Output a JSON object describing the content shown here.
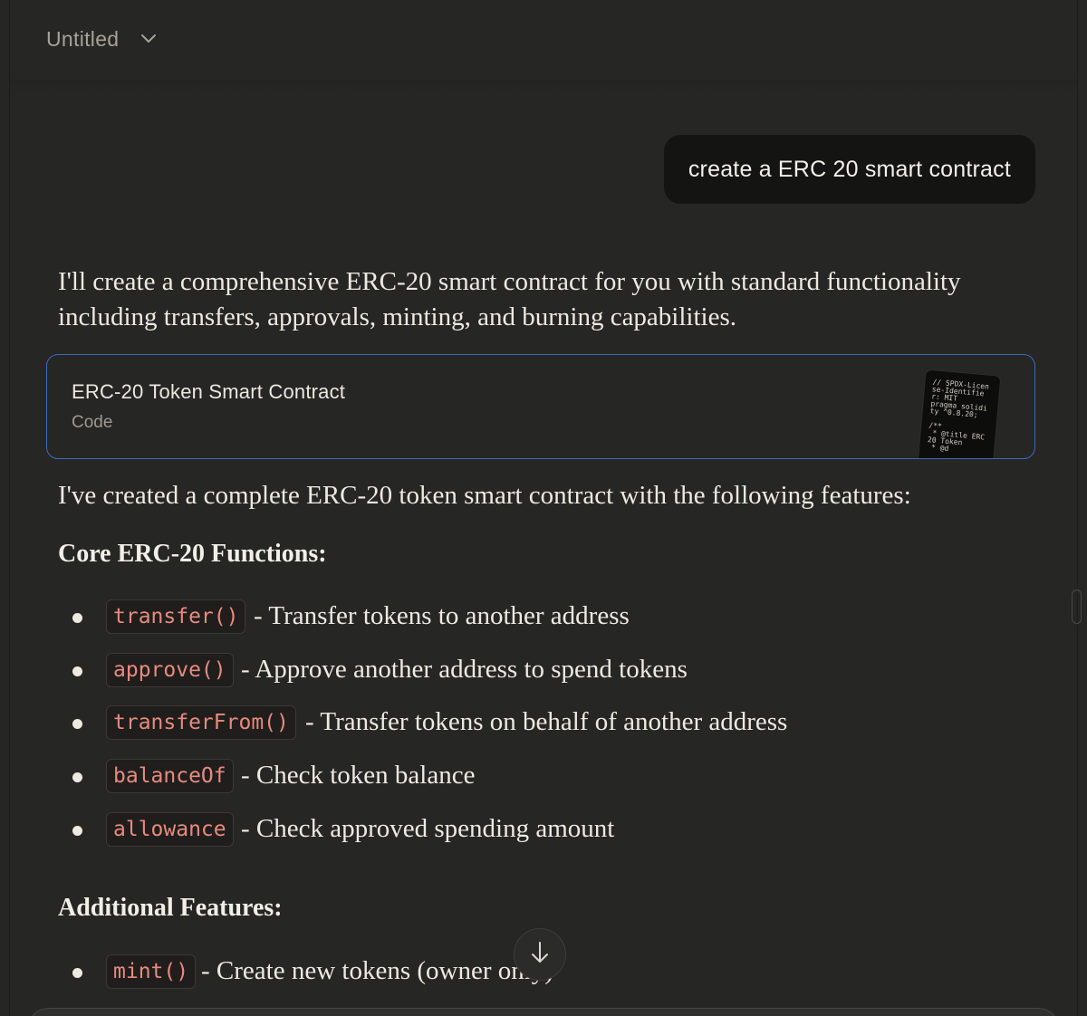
{
  "header": {
    "title": "Untitled"
  },
  "user_message": "create a ERC 20 smart contract",
  "assistant": {
    "intro": "I'll create a comprehensive ERC-20 smart contract for you with standard functionality including transfers, approvals, minting, and burning capabilities.",
    "artifact": {
      "title": "ERC-20 Token Smart Contract",
      "type": "Code",
      "preview": "// SPDX-License-Identifier: MIT\npragma solidity ^0.8.20;\n\n/**\n * @title ERC20 Token\n * @d"
    },
    "summary": "I've created a complete ERC-20 token smart contract with the following features:",
    "core_heading": "Core ERC-20 Functions:",
    "core_items": [
      {
        "code": "transfer()",
        "desc": "- Transfer tokens to another address"
      },
      {
        "code": "approve()",
        "desc": "- Approve another address to spend tokens"
      },
      {
        "code": "transferFrom()",
        "desc": "- Transfer tokens on behalf of another address"
      },
      {
        "code": "balanceOf",
        "desc": "- Check token balance"
      },
      {
        "code": "allowance",
        "desc": "- Check approved spending amount"
      }
    ],
    "additional_heading": "Additional Features:",
    "additional_items": [
      {
        "code": "mint()",
        "desc": "- Create new tokens (owner only)"
      }
    ]
  },
  "icons": {
    "title_dropdown": "chevron-down-icon",
    "scroll_down": "arrow-down-icon"
  }
}
